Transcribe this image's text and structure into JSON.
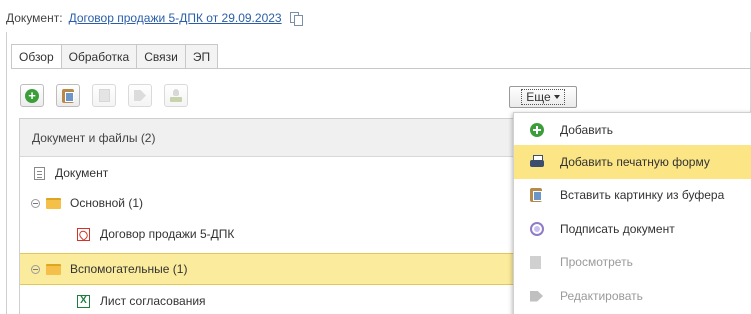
{
  "header": {
    "label": "Документ:",
    "document_link": "Договор продажи 5-ДПК от 29.09.2023",
    "copy_icon": "copy-link-icon"
  },
  "tabs": [
    {
      "label": "Обзор",
      "active": true
    },
    {
      "label": "Обработка",
      "active": false
    },
    {
      "label": "Связи",
      "active": false
    },
    {
      "label": "ЭП",
      "active": false
    }
  ],
  "toolbar": {
    "buttons": [
      {
        "icon": "add-icon",
        "enabled": true
      },
      {
        "icon": "paste-icon",
        "enabled": true
      },
      {
        "icon": "view-icon",
        "enabled": false
      },
      {
        "icon": "edit-icon",
        "enabled": false
      },
      {
        "icon": "stamp-icon",
        "enabled": false
      }
    ],
    "more_label": "Еще"
  },
  "tree": {
    "header": "Документ и файлы (2)",
    "rows": [
      {
        "label": "Документ",
        "icon": "document-icon"
      },
      {
        "label": "Основной (1)",
        "icon": "folder-icon",
        "expanded": true
      },
      {
        "label": "Договор продажи 5-ДПК",
        "icon": "pdf-icon"
      },
      {
        "label": "Вспомогательные (1)",
        "icon": "folder-icon",
        "expanded": true,
        "selected": true
      },
      {
        "label": "Лист согласования",
        "icon": "excel-icon"
      }
    ]
  },
  "more_menu": {
    "items": [
      {
        "label": "Добавить",
        "icon": "add-icon",
        "enabled": true
      },
      {
        "label": "Добавить печатную форму",
        "icon": "printer-icon",
        "enabled": true,
        "highlighted": true
      },
      {
        "label": "Вставить картинку из буфера",
        "icon": "paste-icon",
        "enabled": true
      },
      {
        "label": "Подписать документ",
        "icon": "sign-icon",
        "enabled": true
      },
      {
        "label": "Просмотреть",
        "icon": "view-icon",
        "enabled": false
      },
      {
        "label": "Редактировать",
        "icon": "edit-icon",
        "enabled": false
      }
    ]
  },
  "colors": {
    "link": "#2b5ea9",
    "selection": "#fbeb9c",
    "menu_highlight": "#fbe584",
    "add_green": "#3c9e3a"
  }
}
